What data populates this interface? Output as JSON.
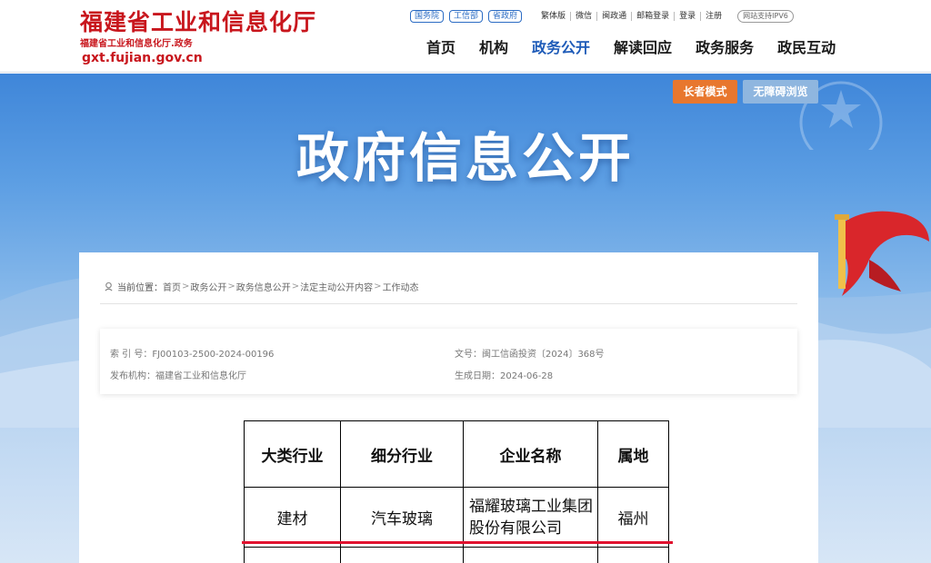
{
  "header": {
    "logo_main": "福建省工业和信息化厅",
    "logo_sub": "福建省工业和信息化厅.政务",
    "logo_domain": "gxt.fujian.gov.cn",
    "pills": [
      "国务院",
      "工信部",
      "省政府"
    ],
    "links": [
      "繁体版",
      "微信",
      "闽政通",
      "邮箱登录",
      "登录",
      "注册"
    ],
    "ipv6": "网站支持IPV6",
    "nav": [
      "首页",
      "机构",
      "政务公开",
      "解读回应",
      "政务服务",
      "政民互动"
    ],
    "active_nav": "政务公开"
  },
  "banner": {
    "title": "政府信息公开",
    "elder_mode": "长者模式",
    "accessible": "无障碍浏览"
  },
  "breadcrumb": {
    "label": "当前位置：",
    "items": [
      "首页",
      "政务公开",
      "政务信息公开",
      "法定主动公开内容",
      "工作动态"
    ],
    "separator": ">"
  },
  "meta": {
    "index_no": "索 引 号：FJ00103-2500-2024-00196",
    "doc_no": "文号：闽工信函投资〔2024〕368号",
    "publisher": "发布机构：福建省工业和信息化厅",
    "date": "生成日期：2024-06-28"
  },
  "table": {
    "headers": [
      "大类行业",
      "细分行业",
      "企业名称",
      "属地"
    ],
    "rows": [
      [
        "建材",
        "汽车玻璃",
        "福耀玻璃工业集团股份有限公司",
        "福州"
      ]
    ]
  },
  "colors": {
    "brand_red": "#c8161d",
    "nav_active": "#1e5bb8",
    "elder_button": "#e8772e",
    "highlight_line": "#e0102e"
  }
}
